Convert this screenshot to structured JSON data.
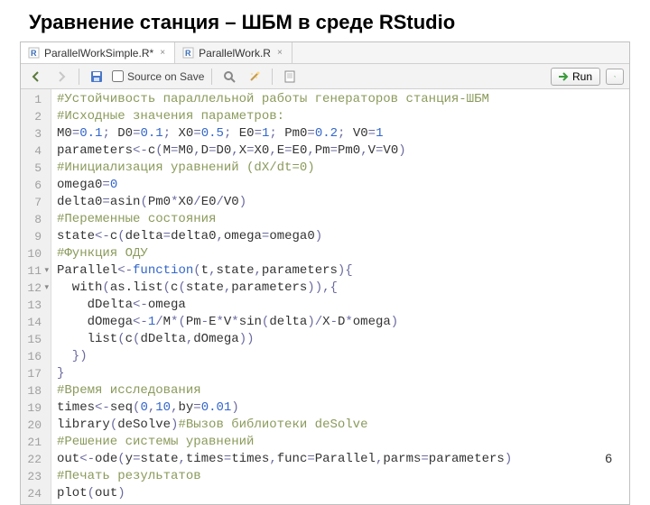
{
  "slide": {
    "title": "Уравнение станция – ШБМ в среде RStudio"
  },
  "tabs": [
    {
      "label": "ParallelWorkSimple.R*",
      "active": true
    },
    {
      "label": "ParallelWork.R",
      "active": false
    }
  ],
  "toolbar": {
    "source_on_save_label": "Source on Save",
    "run_label": "Run"
  },
  "code_lines": [
    {
      "n": 1,
      "fold": false,
      "tokens": [
        [
          "comment",
          "#Устойчивость параллельной работы генераторов станция-ШБМ"
        ]
      ]
    },
    {
      "n": 2,
      "fold": false,
      "tokens": [
        [
          "comment",
          "#Исходные значения параметров:"
        ]
      ]
    },
    {
      "n": 3,
      "fold": false,
      "tokens": [
        [
          "ident",
          "M0"
        ],
        [
          "op",
          "="
        ],
        [
          "num",
          "0.1"
        ],
        [
          "op",
          "; "
        ],
        [
          "ident",
          "D0"
        ],
        [
          "op",
          "="
        ],
        [
          "num",
          "0.1"
        ],
        [
          "op",
          "; "
        ],
        [
          "ident",
          "X0"
        ],
        [
          "op",
          "="
        ],
        [
          "num",
          "0.5"
        ],
        [
          "op",
          "; "
        ],
        [
          "ident",
          "E0"
        ],
        [
          "op",
          "="
        ],
        [
          "num",
          "1"
        ],
        [
          "op",
          "; "
        ],
        [
          "ident",
          "Pm0"
        ],
        [
          "op",
          "="
        ],
        [
          "num",
          "0.2"
        ],
        [
          "op",
          "; "
        ],
        [
          "ident",
          "V0"
        ],
        [
          "op",
          "="
        ],
        [
          "num",
          "1"
        ]
      ]
    },
    {
      "n": 4,
      "fold": false,
      "tokens": [
        [
          "ident",
          "parameters"
        ],
        [
          "assign",
          "<-"
        ],
        [
          "ident",
          "c"
        ],
        [
          "op",
          "("
        ],
        [
          "ident",
          "M"
        ],
        [
          "op",
          "="
        ],
        [
          "ident",
          "M0"
        ],
        [
          "op",
          ","
        ],
        [
          "ident",
          "D"
        ],
        [
          "op",
          "="
        ],
        [
          "ident",
          "D0"
        ],
        [
          "op",
          ","
        ],
        [
          "ident",
          "X"
        ],
        [
          "op",
          "="
        ],
        [
          "ident",
          "X0"
        ],
        [
          "op",
          ","
        ],
        [
          "ident",
          "E"
        ],
        [
          "op",
          "="
        ],
        [
          "ident",
          "E0"
        ],
        [
          "op",
          ","
        ],
        [
          "ident",
          "Pm"
        ],
        [
          "op",
          "="
        ],
        [
          "ident",
          "Pm0"
        ],
        [
          "op",
          ","
        ],
        [
          "ident",
          "V"
        ],
        [
          "op",
          "="
        ],
        [
          "ident",
          "V0"
        ],
        [
          "op",
          ")"
        ]
      ]
    },
    {
      "n": 5,
      "fold": false,
      "tokens": [
        [
          "comment",
          "#Инициализация уравнений (dX/dt=0)"
        ]
      ]
    },
    {
      "n": 6,
      "fold": false,
      "tokens": [
        [
          "ident",
          "omega0"
        ],
        [
          "op",
          "="
        ],
        [
          "num",
          "0"
        ]
      ]
    },
    {
      "n": 7,
      "fold": false,
      "tokens": [
        [
          "ident",
          "delta0"
        ],
        [
          "op",
          "="
        ],
        [
          "ident",
          "asin"
        ],
        [
          "op",
          "("
        ],
        [
          "ident",
          "Pm0"
        ],
        [
          "op",
          "*"
        ],
        [
          "ident",
          "X0"
        ],
        [
          "op",
          "/"
        ],
        [
          "ident",
          "E0"
        ],
        [
          "op",
          "/"
        ],
        [
          "ident",
          "V0"
        ],
        [
          "op",
          ")"
        ]
      ]
    },
    {
      "n": 8,
      "fold": false,
      "tokens": [
        [
          "comment",
          "#Переменные состояния"
        ]
      ]
    },
    {
      "n": 9,
      "fold": false,
      "tokens": [
        [
          "ident",
          "state"
        ],
        [
          "assign",
          "<-"
        ],
        [
          "ident",
          "c"
        ],
        [
          "op",
          "("
        ],
        [
          "ident",
          "delta"
        ],
        [
          "op",
          "="
        ],
        [
          "ident",
          "delta0"
        ],
        [
          "op",
          ","
        ],
        [
          "ident",
          "omega"
        ],
        [
          "op",
          "="
        ],
        [
          "ident",
          "omega0"
        ],
        [
          "op",
          ")"
        ]
      ]
    },
    {
      "n": 10,
      "fold": false,
      "tokens": [
        [
          "comment",
          "#Функция ОДУ"
        ]
      ]
    },
    {
      "n": 11,
      "fold": true,
      "tokens": [
        [
          "ident",
          "Parallel"
        ],
        [
          "assign",
          "<-"
        ],
        [
          "kw",
          "function"
        ],
        [
          "op",
          "("
        ],
        [
          "ident",
          "t"
        ],
        [
          "op",
          ","
        ],
        [
          "ident",
          "state"
        ],
        [
          "op",
          ","
        ],
        [
          "ident",
          "parameters"
        ],
        [
          "op",
          "){"
        ]
      ]
    },
    {
      "n": 12,
      "fold": true,
      "tokens": [
        [
          "ident",
          "  with"
        ],
        [
          "op",
          "("
        ],
        [
          "ident",
          "as.list"
        ],
        [
          "op",
          "("
        ],
        [
          "ident",
          "c"
        ],
        [
          "op",
          "("
        ],
        [
          "ident",
          "state"
        ],
        [
          "op",
          ","
        ],
        [
          "ident",
          "parameters"
        ],
        [
          "op",
          ")),{"
        ]
      ]
    },
    {
      "n": 13,
      "fold": false,
      "tokens": [
        [
          "ident",
          "    dDelta"
        ],
        [
          "assign",
          "<-"
        ],
        [
          "ident",
          "omega"
        ]
      ]
    },
    {
      "n": 14,
      "fold": false,
      "tokens": [
        [
          "ident",
          "    dOmega"
        ],
        [
          "assign",
          "<-"
        ],
        [
          "num",
          "1"
        ],
        [
          "op",
          "/"
        ],
        [
          "ident",
          "M"
        ],
        [
          "op",
          "*("
        ],
        [
          "ident",
          "Pm"
        ],
        [
          "op",
          "-"
        ],
        [
          "ident",
          "E"
        ],
        [
          "op",
          "*"
        ],
        [
          "ident",
          "V"
        ],
        [
          "op",
          "*"
        ],
        [
          "ident",
          "sin"
        ],
        [
          "op",
          "("
        ],
        [
          "ident",
          "delta"
        ],
        [
          "op",
          ")"
        ],
        [
          "op",
          "/"
        ],
        [
          "ident",
          "X"
        ],
        [
          "op",
          "-"
        ],
        [
          "ident",
          "D"
        ],
        [
          "op",
          "*"
        ],
        [
          "ident",
          "omega"
        ],
        [
          "op",
          ")"
        ]
      ]
    },
    {
      "n": 15,
      "fold": false,
      "tokens": [
        [
          "ident",
          "    list"
        ],
        [
          "op",
          "("
        ],
        [
          "ident",
          "c"
        ],
        [
          "op",
          "("
        ],
        [
          "ident",
          "dDelta"
        ],
        [
          "op",
          ","
        ],
        [
          "ident",
          "dOmega"
        ],
        [
          "op",
          "))"
        ]
      ]
    },
    {
      "n": 16,
      "fold": false,
      "tokens": [
        [
          "op",
          "  })"
        ]
      ]
    },
    {
      "n": 17,
      "fold": false,
      "tokens": [
        [
          "op",
          "}"
        ]
      ]
    },
    {
      "n": 18,
      "fold": false,
      "tokens": [
        [
          "comment",
          "#Время исследования"
        ]
      ]
    },
    {
      "n": 19,
      "fold": false,
      "tokens": [
        [
          "ident",
          "times"
        ],
        [
          "assign",
          "<-"
        ],
        [
          "ident",
          "seq"
        ],
        [
          "op",
          "("
        ],
        [
          "num",
          "0"
        ],
        [
          "op",
          ","
        ],
        [
          "num",
          "10"
        ],
        [
          "op",
          ","
        ],
        [
          "ident",
          "by"
        ],
        [
          "op",
          "="
        ],
        [
          "num",
          "0.01"
        ],
        [
          "op",
          ")"
        ]
      ]
    },
    {
      "n": 20,
      "fold": false,
      "tokens": [
        [
          "ident",
          "library"
        ],
        [
          "op",
          "("
        ],
        [
          "ident",
          "deSolve"
        ],
        [
          "op",
          ")"
        ],
        [
          "comment",
          "#Вызов библиотеки deSolve"
        ]
      ]
    },
    {
      "n": 21,
      "fold": false,
      "tokens": [
        [
          "comment",
          "#Решение системы уравнений"
        ]
      ]
    },
    {
      "n": 22,
      "fold": false,
      "tokens": [
        [
          "ident",
          "out"
        ],
        [
          "assign",
          "<-"
        ],
        [
          "ident",
          "ode"
        ],
        [
          "op",
          "("
        ],
        [
          "ident",
          "y"
        ],
        [
          "op",
          "="
        ],
        [
          "ident",
          "state"
        ],
        [
          "op",
          ","
        ],
        [
          "ident",
          "times"
        ],
        [
          "op",
          "="
        ],
        [
          "ident",
          "times"
        ],
        [
          "op",
          ","
        ],
        [
          "ident",
          "func"
        ],
        [
          "op",
          "="
        ],
        [
          "ident",
          "Parallel"
        ],
        [
          "op",
          ","
        ],
        [
          "ident",
          "parms"
        ],
        [
          "op",
          "="
        ],
        [
          "ident",
          "parameters"
        ],
        [
          "op",
          ")"
        ]
      ]
    },
    {
      "n": 23,
      "fold": false,
      "tokens": [
        [
          "comment",
          "#Печать результатов"
        ]
      ]
    },
    {
      "n": 24,
      "fold": false,
      "tokens": [
        [
          "ident",
          "plot"
        ],
        [
          "op",
          "("
        ],
        [
          "ident",
          "out"
        ],
        [
          "op",
          ")"
        ]
      ]
    }
  ],
  "page_number": "6"
}
